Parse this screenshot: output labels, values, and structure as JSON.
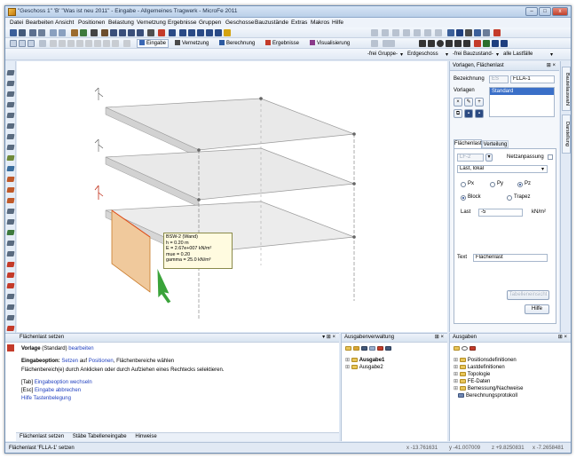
{
  "window": {
    "title": "\"Geschoss 1\" 'B' \"Was ist neu 2011\" - Eingabe - Allgemeines Tragwerk - MicroFe 2011",
    "minimize": "–",
    "maximize": "□",
    "close": "x"
  },
  "menu": [
    "Datei",
    "Bearbeiten",
    "Ansicht",
    "Positionen",
    "Belastung",
    "Vernetzung",
    "Ergebnisse",
    "Gruppen",
    "Geschosse",
    "Bauzustände",
    "Extras",
    "Makros",
    "Hilfe"
  ],
  "toolbar2": {
    "eingabe": "Eingabe",
    "vernetzung": "Vernetzung",
    "berechnung": "Berechnung",
    "ergebnisse": "Ergebnisse",
    "visualisierung": "Visualisierung"
  },
  "toolbar3": {
    "gruppe": "-frei Gruppe-",
    "geschoss": "Erdgeschoss",
    "bauzustand": "-frei Bauzustand-",
    "lastfaelle": "alle Lastfälle"
  },
  "tooltip": {
    "lines": [
      "BSW-2 (Wand)",
      "h = 0.20 m",
      "E = 2.67e+007 kN/m²",
      "mue = 0.20",
      "gamma = 25.0 kN/m³"
    ]
  },
  "right_panel": {
    "header": "Vorlagen, Flächenlast",
    "bezeichnung_label": "Bezeichnung",
    "bezeichnung_prefix": "ES",
    "bezeichnung_value": "FLLA-1",
    "vorlagen_label": "Vorlagen",
    "vorlagen_selected": "Standard",
    "tabs": [
      "Flächenlast",
      "Verteilung"
    ],
    "lastfall": "LF-2",
    "netzanpassung_label": "Netzanpassung",
    "lastart": "Last, lokal",
    "direction_options": [
      "Px",
      "Py",
      "Pz"
    ],
    "direction_selected": "Pz",
    "shape_options": [
      "Block",
      "Trapez"
    ],
    "shape_selected": "Block",
    "last_label": "Last",
    "last_value": "-5",
    "last_unit": "kN/m²",
    "text_label": "Text",
    "text_value": "Flächenlast",
    "tabelleneinsicht_button": "Tabelleneinsicht",
    "hilfe_button": "Hilfe"
  },
  "side_tabs": [
    "Bauteilauswahl",
    "Darstellung"
  ],
  "bottom_left": {
    "header": "Flächenlast setzen",
    "line1_prefix": "Vorlage",
    "line1_mid": "(Standard)",
    "line1_link": "bearbeiten",
    "line2_bold": "Eingabeoption:",
    "line2_link1": "Setzen",
    "line2_mid": "auf",
    "line2_link2": "Positionen",
    "line2_rest": ", Flächenbereiche wählen",
    "line3": "Flächenbereich(e) durch Anklicken oder durch Aufziehen eines Rechtecks selektieren.",
    "line4_key": "[Tab]",
    "line4_link": "Eingabeoption wechseln",
    "line5_key": "[Esc]",
    "line5_link": "Eingabe abbrechen",
    "line6_link": "Hilfe Tastenbelegung",
    "tabs": [
      "Flächenlast setzen",
      "Stäbe Tabelleneingabe",
      "Hinweise"
    ]
  },
  "bottom_mid": {
    "header": "Ausgabenverwaltung",
    "items": [
      "Ausgabe1",
      "Ausgabe2"
    ]
  },
  "bottom_right": {
    "header": "Ausgaben",
    "items": [
      "Positionsdefinitionen",
      "Lastdefinitionen",
      "Topologie",
      "FE-Daten",
      "Bemessung/Nachweise",
      "Berechnungsprotokoll"
    ]
  },
  "status": {
    "left": "Flächenlast 'FLLA-1' setzen",
    "coords": [
      "x  -13.761631",
      "y  -41.007009",
      "z  +9.8250831",
      "x  -7.2658481"
    ]
  },
  "colors": {
    "accent": "#1f3fbf",
    "wall": "#f0c99c",
    "cursor": "#3aa33a"
  }
}
